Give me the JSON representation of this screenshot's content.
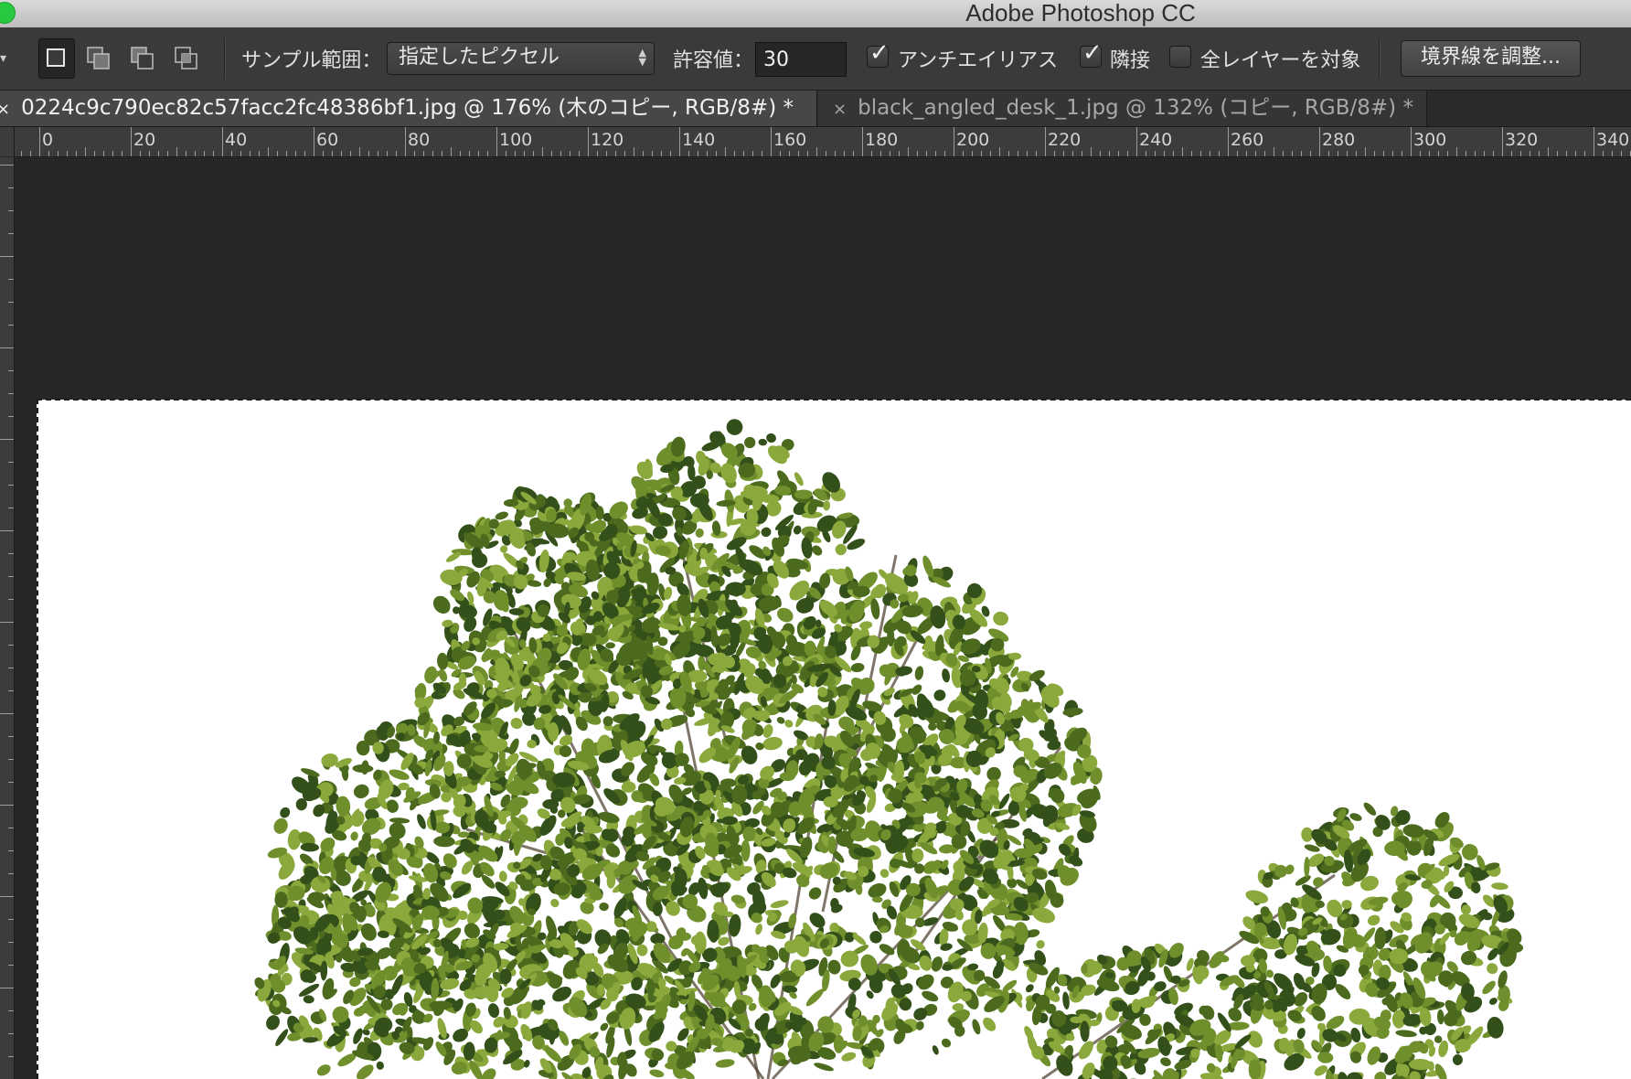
{
  "window": {
    "app_title": "Adobe Photoshop CC"
  },
  "options_bar": {
    "selection_modes": [
      {
        "name": "new-selection",
        "active": true
      },
      {
        "name": "add-to-selection",
        "active": false
      },
      {
        "name": "subtract-from-selection",
        "active": false
      },
      {
        "name": "intersect-with-selection",
        "active": false
      }
    ],
    "sample_size_label": "サンプル範囲：",
    "sample_size_value": "指定したピクセル",
    "tolerance_label": "許容値：",
    "tolerance_value": "30",
    "anti_alias": {
      "label": "アンチエイリアス",
      "checked": true
    },
    "contiguous": {
      "label": "隣接",
      "checked": true
    },
    "sample_all_layers": {
      "label": "全レイヤーを対象",
      "checked": false
    },
    "refine_edge_button": "境界線を調整..."
  },
  "tabs": [
    {
      "title": "0224c9c790ec82c57facc2fc48386bf1.jpg @ 176% (木のコピー, RGB/8#) *",
      "active": true
    },
    {
      "title": "black_angled_desk_1.jpg @ 132% (コピー, RGB/8#) *",
      "active": false
    }
  ],
  "ruler": {
    "labels": [
      "0",
      "20",
      "40",
      "60",
      "80",
      "100",
      "120",
      "140",
      "160",
      "180",
      "200",
      "220",
      "240",
      "260",
      "280",
      "300",
      "320",
      "340"
    ]
  },
  "canvas": {
    "content": "tree-photo",
    "background_color": "#ffffff",
    "foliage_colors": [
      "#4b6a1e",
      "#6f8e2c",
      "#34501a",
      "#8aa83c"
    ]
  }
}
